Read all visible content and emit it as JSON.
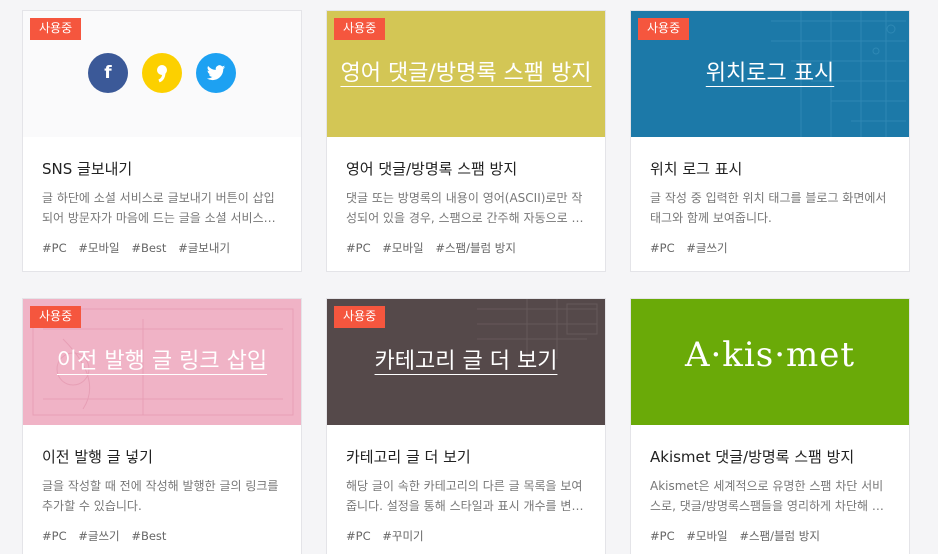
{
  "badge": "사용중",
  "colors": {
    "badge": "#f5563e",
    "sns_bg": "#fafafb",
    "facebook": "#3b5998",
    "kakao": "#fcd000",
    "twitter": "#1da1f2",
    "spam_bg": "#d3c655",
    "location_bg": "#1c79a8",
    "prev_bg": "#f0b3c6",
    "category_bg": "#55494a",
    "akismet_bg": "#6aaa08"
  },
  "cards": [
    {
      "thumb_icons": [
        "facebook-icon",
        "kakao-icon",
        "twitter-icon"
      ],
      "title": "SNS 글보내기",
      "desc": "글 하단에 소셜 서비스로 글보내기 버튼이 삽입되어 방문자가 마음에 드는 글을 소셜 서비스로 쉽게 보낼 수 있습니다.",
      "tags": [
        "#PC",
        "#모바일",
        "#Best",
        "#글보내기"
      ]
    },
    {
      "thumb_title": "영어 댓글/방명록 스팸 방지",
      "title": "영어 댓글/방명록 스팸 방지",
      "desc": "댓글 또는 방명록의 내용이 영어(ASCII)로만 작성되어 있을 경우, 스팸으로 간주해 자동으로 차단합니다.",
      "tags": [
        "#PC",
        "#모바일",
        "#스팸/블럼 방지"
      ]
    },
    {
      "thumb_title": "위치로그 표시",
      "title": "위치 로그 표시",
      "desc": "글 작성 중 입력한 위치 태그를 블로그 화면에서 태그와 함께 보여줍니다.",
      "tags": [
        "#PC",
        "#글쓰기"
      ]
    },
    {
      "thumb_title": "이전 발행 글 링크 삽입",
      "title": "이전 발행 글 넣기",
      "desc": "글을 작성할 때 전에 작성해 발행한 글의 링크를 추가할 수 있습니다.",
      "tags": [
        "#PC",
        "#글쓰기",
        "#Best"
      ]
    },
    {
      "thumb_title": "카테고리 글 더 보기",
      "title": "카테고리 글 더 보기",
      "desc": "해당 글이 속한 카테고리의 다른 글 목록을 보여줍니다. 설정을 통해 스타일과 표시 개수를 변경할 수 있습니다.",
      "tags": [
        "#PC",
        "#꾸미기"
      ]
    },
    {
      "thumb_logo": "A·kis·met",
      "title": "Akismet 댓글/방명록 스팸 방지",
      "desc": "Akismet은 세계적으로 유명한 스팸 차단 서비스로, 댓글/방명록스팸들을 영리하게 차단해 줍니다.",
      "tags": [
        "#PC",
        "#모바일",
        "#스팸/블럼 방지"
      ]
    }
  ]
}
